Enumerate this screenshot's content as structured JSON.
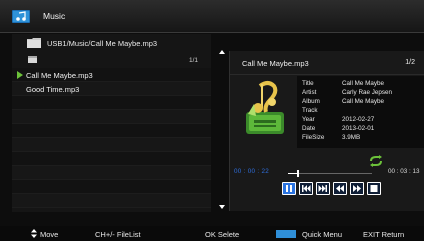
{
  "header": {
    "title": "Music",
    "icon": "music-app-icon"
  },
  "browser": {
    "path": "USB1/Music/Call Me Maybe.mp3",
    "page_counter": "1/1",
    "files": [
      {
        "name": "Call Me Maybe.mp3",
        "playing": true
      },
      {
        "name": "Good Time.mp3",
        "playing": false
      }
    ]
  },
  "now_playing": {
    "title": "Call Me Maybe.mp3",
    "index": "1/2",
    "metadata": [
      {
        "key": "Title",
        "value": "Call Me Maybe"
      },
      {
        "key": "Artist",
        "value": "Carly Rae Jepsen"
      },
      {
        "key": "Album",
        "value": "Call Me Maybe"
      },
      {
        "key": "Track",
        "value": ""
      },
      {
        "key": "Year",
        "value": "2012-02-27"
      },
      {
        "key": "Date",
        "value": "2013-02-01"
      },
      {
        "key": "FileSize",
        "value": "3.9MB"
      }
    ],
    "time_current": "00 : 00 : 22",
    "time_total": "00 : 03 : 13",
    "progress_fraction": 0.114,
    "controls": [
      "pause-icon",
      "skip-previous-icon",
      "skip-next-icon",
      "rewind-icon",
      "fast-forward-icon",
      "stop-icon"
    ]
  },
  "footer": {
    "move": "Move",
    "filelist": "CH+/-  FileList",
    "select": "OK  Selete",
    "quick_menu": "Quick Menu",
    "exit": "EXIT  Return"
  },
  "colors": {
    "accent_blue": "#2f8fd8",
    "play_marker_green": "#6cc23a",
    "current_time_blue": "#2f6edc"
  }
}
